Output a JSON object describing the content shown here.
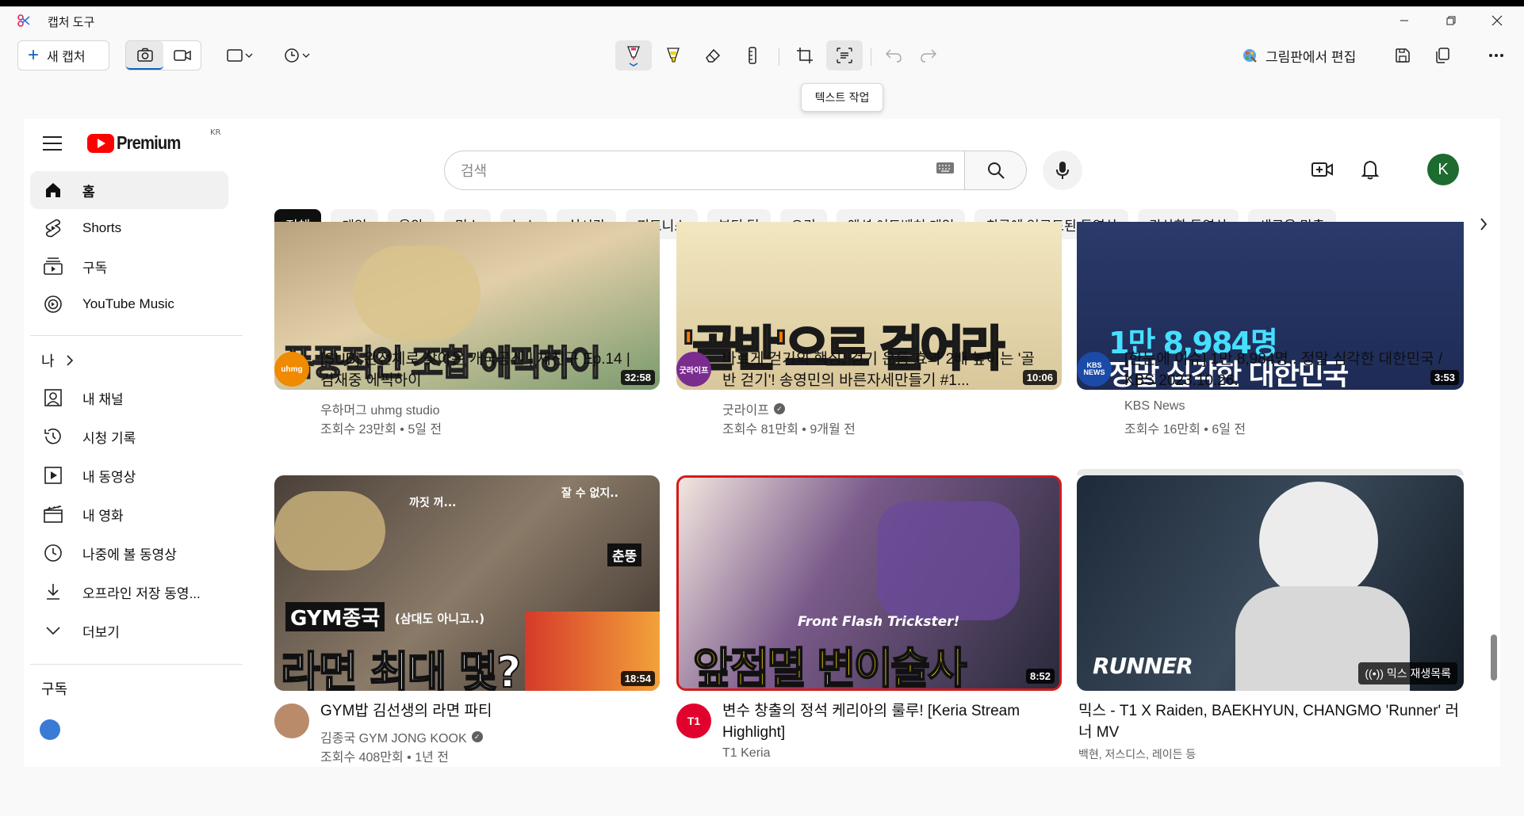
{
  "window": {
    "title": "캡처 도구",
    "new_capture": "새 캡처",
    "paint_edit": "그림판에서 편집",
    "tooltip": "텍스트 작업"
  },
  "youtube": {
    "logo_text": "Premium",
    "region": "KR",
    "search_placeholder": "검색",
    "avatar_letter": "K",
    "sidebar": {
      "main": [
        {
          "label": "홈",
          "icon": "home-icon"
        },
        {
          "label": "Shorts",
          "icon": "shorts-icon"
        },
        {
          "label": "구독",
          "icon": "subscriptions-icon"
        },
        {
          "label": "YouTube Music",
          "icon": "music-icon"
        }
      ],
      "me_heading": "나",
      "me": [
        {
          "label": "내 채널",
          "icon": "channel-icon"
        },
        {
          "label": "시청 기록",
          "icon": "history-icon"
        },
        {
          "label": "내 동영상",
          "icon": "my-videos-icon"
        },
        {
          "label": "내 영화",
          "icon": "movies-icon"
        },
        {
          "label": "나중에 볼 동영상",
          "icon": "watch-later-icon"
        },
        {
          "label": "오프라인 저장 동영...",
          "icon": "download-icon"
        },
        {
          "label": "더보기",
          "icon": "chevron-down-icon"
        }
      ],
      "subs_heading": "구독"
    },
    "chips": [
      "전체",
      "게임",
      "음악",
      "믹스",
      "뉴스",
      "실시간",
      "피트니스",
      "뷰티 팁",
      "요리",
      "액션 어드벤처 게임",
      "최근에 업로드된 동영상",
      "감상한 동영상",
      "새로운 맞춤"
    ],
    "videos": [
      {
        "title": "[SUB] 완전체로 찾아온 개국공신 | 재친구 Ep.14 | 김재중 에픽하이",
        "channel": "우하머그 uhmg studio",
        "verified": false,
        "stats": "조회수 23만회 • 5일 전",
        "duration": "32:58",
        "thumb_text": "폭풍적인 조합 에픽하이",
        "avatar_text": "uhmg",
        "avatar_color": "#f08a00"
      },
      {
        "title": "바르게 걷기의 핵심, 걷기 운동 효과 2배 높이는 '골반 걷기'! 송영민의 바른자세만들기 #1...",
        "channel": "굿라이프",
        "verified": true,
        "stats": "조회수 81만회 • 9개월 전",
        "duration": "10:06",
        "thumb_text": "'골반'으로 걸어라",
        "avatar_text": "굿라이프",
        "avatar_color": "#7a2c8f"
      },
      {
        "title": "[한눈에 이슈] 1만 8,984명.. 정말 심각한 대한민국 / KBS 2023.10.26.",
        "channel": "KBS News",
        "verified": false,
        "stats": "조회수 16만회 • 6일 전",
        "duration": "3:53",
        "thumb_text": "1만 8,984명",
        "thumb_text2": "정말 심각한 대한민국",
        "avatar_text": "KBS NEWS",
        "avatar_color": "#1c4aa8"
      },
      {
        "title": "GYM밥 김선생의 라면 파티",
        "channel": "김종국 GYM JONG KOOK",
        "verified": true,
        "stats": "조회수 408만회 • 1년 전",
        "duration": "18:54",
        "thumb_text": "라면 최대 몇?",
        "thumb_text2": "GYM종국",
        "thumb_text3": "(삼대도 아니고..)",
        "thumb_text4": "춘뚱",
        "thumb_text5": "까짓 꺼...",
        "thumb_text6": "잘 수 없지..",
        "avatar_text": "",
        "avatar_color": "#b98b6a"
      },
      {
        "title": "변수 창출의 정석 케리아의 룰루! [Keria Stream Highlight]",
        "channel": "T1 Keria",
        "verified": false,
        "stats": "",
        "duration": "8:52",
        "thumb_text": "앞점멸 변이술사",
        "thumb_text2": "Front Flash Trickster!",
        "avatar_text": "T1",
        "avatar_color": "#e2012d"
      },
      {
        "title": "믹스 - T1 X Raiden, BAEKHYUN, CHANGMO 'Runner' 러너 MV",
        "channel": "백현, 저스디스, 레이든 등",
        "verified": false,
        "stats": "",
        "duration": "",
        "thumb_text": "RUNNER",
        "mix_label": "믹스 재생목록",
        "avatar_text": "",
        "avatar_color": ""
      }
    ]
  },
  "colors": {
    "accent": "#0a5fc4",
    "yt_red": "#ff0000",
    "chip_active": "#0f0f0f"
  }
}
